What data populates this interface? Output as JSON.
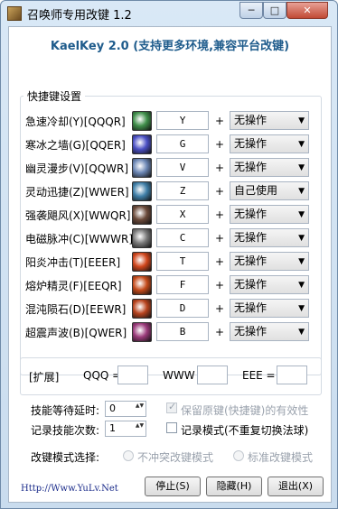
{
  "window": {
    "title": "召唤师专用改键 1.2",
    "min_glyph": "─",
    "max_glyph": "□",
    "close_glyph": "✕"
  },
  "header": "KaelKey 2.0 (支持更多环境,兼容平台改键)",
  "hotkey_group_title": "快捷键设置",
  "skills": [
    {
      "label": "急速冷却(Y)[QQQR]",
      "key": "Y",
      "action": "无操作",
      "icon_color": "#3f8f4a"
    },
    {
      "label": "寒冰之墙(G)[QQER]",
      "key": "G",
      "action": "无操作",
      "icon_color": "#4a4fc4"
    },
    {
      "label": "幽灵漫步(V)[QQWR]",
      "key": "V",
      "action": "无操作",
      "icon_color": "#6b86b4"
    },
    {
      "label": "灵动迅捷(Z)[WWER]",
      "key": "Z",
      "action": "自己使用",
      "icon_color": "#3f7fa8"
    },
    {
      "label": "强袭飓风(X)[WWQR]",
      "key": "X",
      "action": "无操作",
      "icon_color": "#6b4a3a"
    },
    {
      "label": "电磁脉冲(C)[WWWR]",
      "key": "C",
      "action": "无操作",
      "icon_color": "#7a7a7a"
    },
    {
      "label": "阳炎冲击(T)[EEER]",
      "key": "T",
      "action": "无操作",
      "icon_color": "#d0451b"
    },
    {
      "label": "熔炉精灵(F)[EEQR]",
      "key": "F",
      "action": "无操作",
      "icon_color": "#c44a1a"
    },
    {
      "label": "混沌陨石(D)[EEWR]",
      "key": "D",
      "action": "无操作",
      "icon_color": "#b8431e"
    },
    {
      "label": "超震声波(B)[QWER]",
      "key": "B",
      "action": "无操作",
      "icon_color": "#9a3a7a"
    }
  ],
  "plus": "+",
  "combo_arrow": "▼",
  "extended": {
    "label": "[扩展]",
    "qqq": "QQQ =",
    "www": "WWW",
    "eee": "EEE ="
  },
  "options": {
    "delay_label": "技能等待延时:",
    "delay_value": "0",
    "count_label": "记录技能次数:",
    "count_value": "1",
    "keep_original": "保留原键(快捷键)的有效性",
    "record_mode": "记录模式(不重复切换法球)",
    "mode_label": "改键模式选择:",
    "mode_a": "不冲突改键模式",
    "mode_b": "标准改键模式",
    "spin_arrows": "▲▼"
  },
  "footer": {
    "url": "Http://Www.YuLv.Net",
    "stop": "停止(S)",
    "hide": "隐藏(H)",
    "exit": "退出(X)"
  }
}
